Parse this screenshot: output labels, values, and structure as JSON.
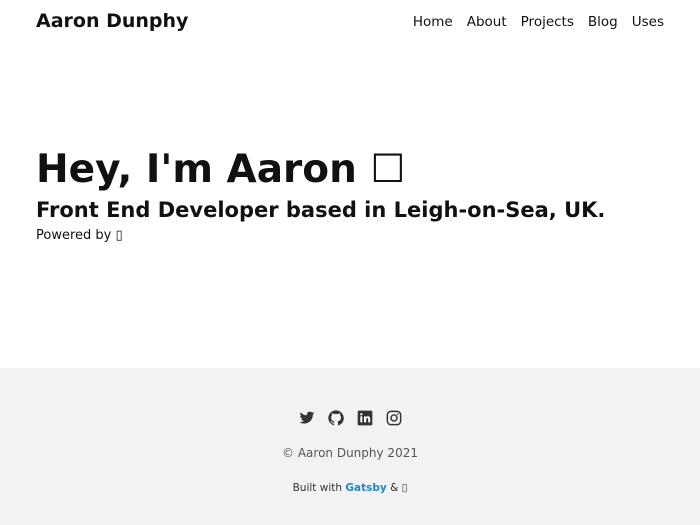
{
  "header": {
    "site_title": "Aaron Dunphy",
    "nav": [
      {
        "label": "Home"
      },
      {
        "label": "About"
      },
      {
        "label": "Projects"
      },
      {
        "label": "Blog"
      },
      {
        "label": "Uses"
      }
    ]
  },
  "hero": {
    "title": "Hey, I'm Aaron",
    "title_icon": "☐",
    "subtitle": "Front End Developer based in Leigh-on-Sea, UK.",
    "powered_label": "Powered by",
    "powered_icon": "▯"
  },
  "footer": {
    "social_icons": [
      "twitter-icon",
      "github-icon",
      "linkedin-icon",
      "instagram-icon"
    ],
    "copyright": "© Aaron Dunphy 2021",
    "built_with_prefix": "Built with",
    "built_with_link": "Gatsby",
    "built_with_amp": "&",
    "built_with_icon": "▯",
    "colors": {
      "background": "#f2f2f2",
      "link": "#1e88c7",
      "icon": "#333333"
    }
  }
}
